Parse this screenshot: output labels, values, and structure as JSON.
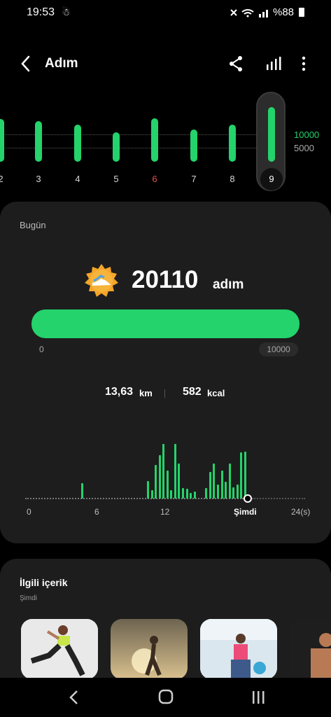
{
  "status": {
    "time": "19:53",
    "battery": "%88"
  },
  "header": {
    "title": "Adım"
  },
  "week": {
    "days": [
      {
        "label": "2",
        "steps": 12000
      },
      {
        "label": "3",
        "steps": 11500
      },
      {
        "label": "4",
        "steps": 10500
      },
      {
        "label": "5",
        "steps": 8200
      },
      {
        "label": "6",
        "steps": 12200
      },
      {
        "label": "7",
        "steps": 9000
      },
      {
        "label": "8",
        "steps": 10500
      },
      {
        "label": "9",
        "steps": 20110
      }
    ],
    "goal_high": "10000",
    "goal_low": "5000",
    "highlight_color": "#e0554c"
  },
  "today": {
    "label": "Bugün",
    "steps": "20110",
    "unit": "adım",
    "progress_min": "0",
    "progress_max": "10000",
    "progress_fraction": 1.0,
    "distance_value": "13,63",
    "distance_unit": "km",
    "kcal_value": "582",
    "kcal_unit": "kcal"
  },
  "hourly": {
    "axis_labels": [
      "0",
      "6",
      "12",
      "Şimdi",
      "24(s)"
    ],
    "values": [
      0,
      0,
      0,
      0,
      0,
      0,
      0,
      0,
      0,
      0,
      0,
      0,
      0,
      0,
      22,
      0,
      0,
      0,
      0,
      0,
      0,
      0,
      0,
      0,
      0,
      0,
      0,
      0,
      0,
      0,
      0,
      25,
      12,
      48,
      62,
      78,
      40,
      12,
      78,
      50,
      15,
      14,
      8,
      10,
      0,
      0,
      15,
      38,
      50,
      20,
      40,
      24,
      50,
      16,
      20,
      66,
      67
    ]
  },
  "related": {
    "title": "İlgili içerik",
    "subtitle": "Şimdi"
  },
  "accent": "#24d36b"
}
